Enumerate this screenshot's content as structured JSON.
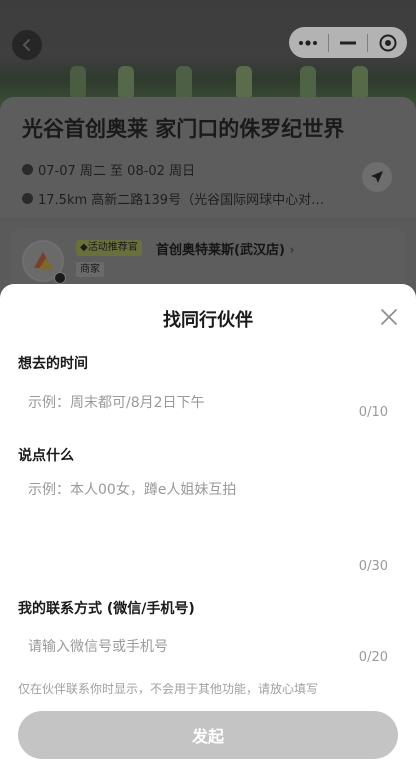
{
  "capsule": {
    "more_icon": "more-dots-icon",
    "minimize_icon": "minimize-icon",
    "close_icon": "target-icon"
  },
  "event": {
    "title": "光谷首创奥莱 家门口的侏罗纪世界",
    "date": "07-07 周二 至 08-02 周日",
    "location": "17.5km 高新二路139号（光谷国际网球中心对…"
  },
  "merchant": {
    "tag": "◆活动推荐官",
    "name": "首创奥特莱斯(武汉店)",
    "chevron": "›",
    "type": "商家"
  },
  "modal": {
    "title": "找同行伙伴",
    "time_label": "想去的时间",
    "time_placeholder": "示例：周末都可/8月2日下午",
    "time_counter": "0/10",
    "say_label": "说点什么",
    "say_placeholder": "示例：本人00女，蹲e人姐妹互拍",
    "say_counter": "0/30",
    "contact_label": "我的联系方式 (微信/手机号)",
    "contact_placeholder": "请输入微信号或手机号",
    "contact_counter": "0/20",
    "hint": "仅在伙伴联系你时显示，不会用于其他功能，请放心填写",
    "submit_label": "发起"
  },
  "colors": {
    "overlay": "#5a5a5a",
    "sheet": "#ffffff",
    "submit_disabled": "#c4c4c4",
    "placeholder": "#9a9a9a"
  }
}
